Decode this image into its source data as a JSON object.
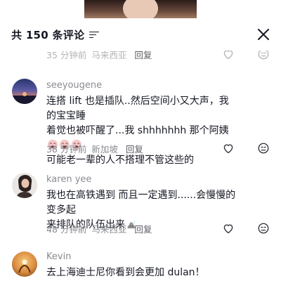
{
  "header": {
    "comment_count_label": "共 150 条评论"
  },
  "comments": [
    {
      "username": "",
      "text": "",
      "time": "35 分钟前",
      "location": "马来西亚",
      "reply_label": "回复"
    },
    {
      "username": "seeyougene",
      "text_lines": [
        "连搭 lift 也是插队..然后空间小又大声，我的宝宝睡",
        "着觉也被吓醒了...我 shhhhhhh 那个阿姨",
        "可能老一辈的人不搭理不管这些的"
      ],
      "time": "38 分钟前",
      "location": "新加坡",
      "reply_label": "回复"
    },
    {
      "username": "karen yee",
      "text_lines": [
        "我也在高铁遇到 而且一定遇到......会慢慢的变多起",
        "来排队的队伍出来"
      ],
      "time": "48 分钟前",
      "location": "马来西亚",
      "reply_label": "回复"
    },
    {
      "username": "Kevin",
      "text_lines": [
        "去上海迪士尼你看到会更加 dulan！"
      ]
    }
  ],
  "colors": {
    "text": "#161823",
    "muted": "#8a8b91",
    "icon": "#2f3036"
  },
  "icons": {
    "filter": "filter-icon",
    "close": "close-icon",
    "like": "heart-outline-icon",
    "dislike": "dislike-face-icon",
    "crying_emoji": "crying-face-emoji",
    "sweat_emoji": "sweat-drop-emoji"
  }
}
